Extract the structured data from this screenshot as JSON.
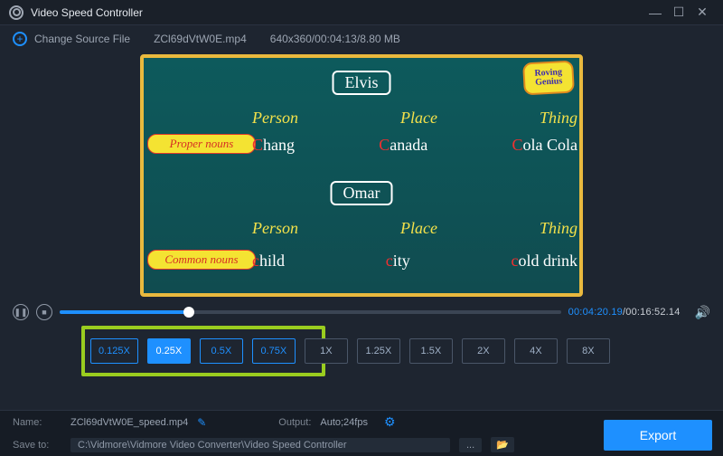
{
  "title": "Video Speed Controller",
  "source": {
    "change_label": "Change Source File",
    "filename": "ZCl69dVtW0E.mp4",
    "meta": "640x360/00:04:13/8.80 MB"
  },
  "video": {
    "badge": "Roving Genius",
    "name1": "Elvis",
    "name2": "Omar",
    "heads": [
      "Person",
      "Place",
      "Thing"
    ],
    "proper_label": "Proper nouns",
    "common_label": "Common nouns",
    "proper_vals": [
      "Chang",
      "Canada",
      "Cola Cola"
    ],
    "common_vals": [
      "child",
      "city",
      "cold drink"
    ]
  },
  "playback": {
    "current": "00:04:20.19",
    "total": "00:16:52.14",
    "sep": "/"
  },
  "speeds": {
    "options": [
      "0.125X",
      "0.25X",
      "0.5X",
      "0.75X",
      "1X",
      "1.25X",
      "1.5X",
      "2X",
      "4X",
      "8X"
    ],
    "active_index": 1,
    "slow_until_index": 3
  },
  "footer": {
    "name_label": "Name:",
    "out_name": "ZCl69dVtW0E_speed.mp4",
    "output_label": "Output:",
    "output_value": "Auto;24fps",
    "saveto_label": "Save to:",
    "path": "C:\\Vidmore\\Vidmore Video Converter\\Video Speed Controller",
    "export": "Export",
    "ell": "..."
  },
  "icons": {
    "pause": "❚❚",
    "stop": "■",
    "volume": "🔊",
    "pen": "✎",
    "gear": "⚙",
    "folder": "📂",
    "plus": "+",
    "min": "—",
    "close": "✕",
    "square": "☐"
  }
}
